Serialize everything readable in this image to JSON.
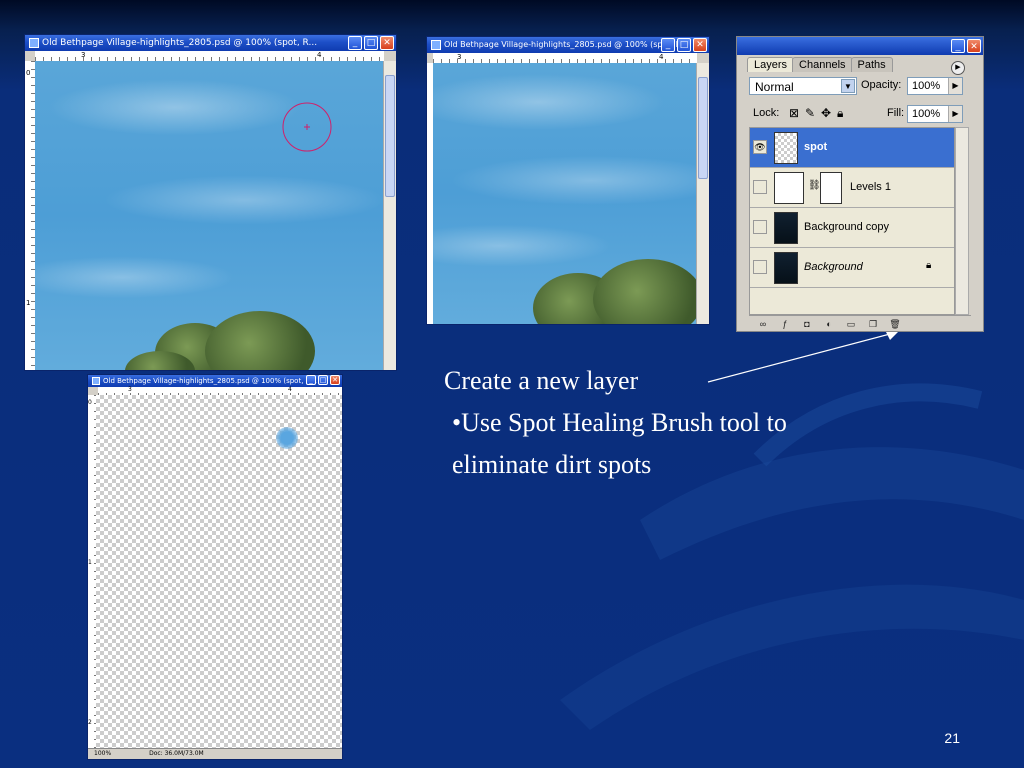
{
  "window_title": "Old Bethpage Village-highlights_2805.psd @ 100% (spot, R...",
  "window_title_short": "Old Bethpage Village-highlights_2805.psd @ 100% (spot, R...",
  "window_buttons": {
    "minimize": "_",
    "maximize": "□",
    "close": "✕"
  },
  "ruler_marks": {
    "top_a": "3",
    "top_b": "4",
    "left_0": "0",
    "left_1": "1",
    "left_2": "2"
  },
  "statusbar": {
    "zoom": "100%",
    "doc": "Doc: 36.0M/73.0M"
  },
  "layers_panel": {
    "tabs": [
      "Layers",
      "Channels",
      "Paths"
    ],
    "blend_mode": "Normal",
    "opacity_label": "Opacity:",
    "opacity_value": "100%",
    "lock_label": "Lock:",
    "fill_label": "Fill:",
    "fill_value": "100%",
    "layers": [
      {
        "name": "spot",
        "visible": true,
        "active": true
      },
      {
        "name": "Levels 1",
        "visible": false,
        "active": false
      },
      {
        "name": "Background copy",
        "visible": false,
        "active": false
      },
      {
        "name": "Background",
        "visible": false,
        "active": false,
        "locked": true
      }
    ]
  },
  "slide": {
    "line1": "Create a new layer",
    "bullet": "•Use Spot Healing Brush tool to",
    "bullet_cont": "eliminate dirt spots",
    "page_number": "21"
  },
  "colors": {
    "background": "#0a2f80",
    "titlebar": "#1d4fc7",
    "active_layer": "#3a6fd0"
  }
}
